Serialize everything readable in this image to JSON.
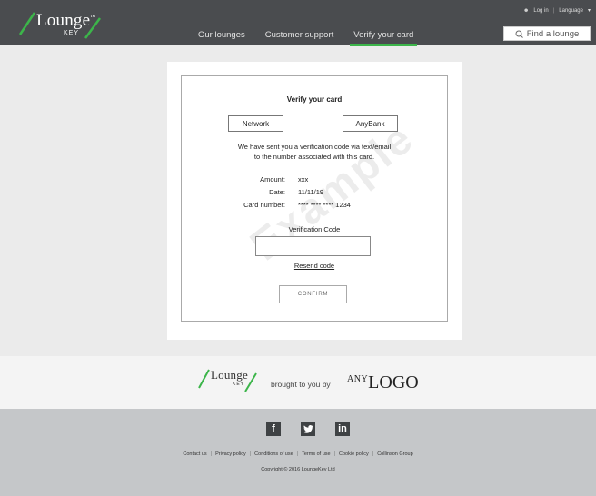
{
  "header": {
    "logo_text": "Lounge",
    "logo_tm": "™",
    "logo_sub": "KEY",
    "nav": [
      "Our lounges",
      "Customer support",
      "Verify your card"
    ],
    "login": "Log in",
    "language": "Language",
    "find_label": "Find a lounge"
  },
  "card": {
    "title": "Verify your card",
    "network": "Network",
    "bank": "AnyBank",
    "message_line1": "We have sent you a verification code via text/email",
    "message_line2": "to the number associated with this card.",
    "amount_label": "Amount:",
    "amount_value": "xxx",
    "date_label": "Date:",
    "date_value": "11/11/19",
    "cardnum_label": "Card number:",
    "cardnum_value": "**** **** **** 1234",
    "code_label": "Verification Code",
    "code_value": "",
    "resend": "Resend code",
    "confirm": "CONFIRM",
    "watermark": "Example"
  },
  "brand": {
    "logo_text": "Lounge",
    "logo_sub": "KEY",
    "brought": "brought to you by",
    "any": "ANY",
    "logo_word": "LOGO"
  },
  "footer": {
    "social": [
      "f",
      "t",
      "in"
    ],
    "links": [
      "Contact us",
      "Privacy policy",
      "Conditions of use",
      "Terms of use",
      "Cookie policy",
      "Collinson Group"
    ],
    "copyright": "Copyright © 2016 LoungeKey Ltd"
  },
  "colors": {
    "header_bg": "#4a4c4f",
    "accent_green": "#3cb54a",
    "footer_bg": "#c5c7c9"
  }
}
